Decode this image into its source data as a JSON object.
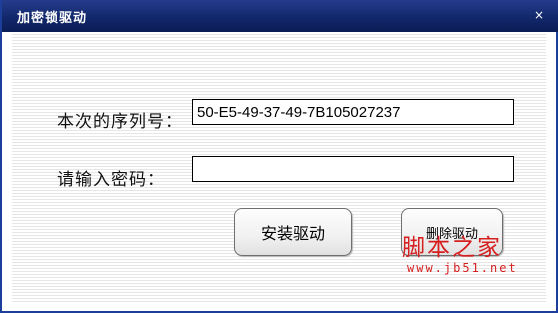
{
  "window": {
    "title": "加密锁驱动",
    "close_glyph": "×"
  },
  "form": {
    "serial_label": "本次的序列号：",
    "serial_value": "50-E5-49-37-49-7B105027237",
    "password_label": "请输入密码：",
    "password_value": ""
  },
  "buttons": {
    "install_label": "安装驱动",
    "remove_label": "删除驱动"
  },
  "watermark": {
    "text": "脚本之家",
    "url": "www.jb51.net"
  },
  "colors": {
    "titlebar": "#12286b",
    "watermark": "#d61e1e"
  }
}
